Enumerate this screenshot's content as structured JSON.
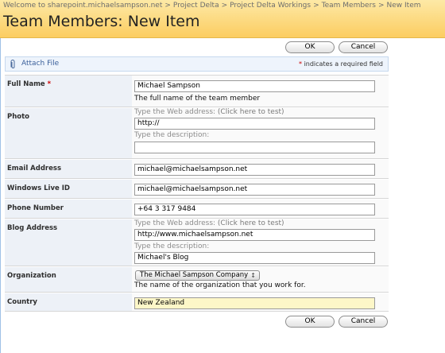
{
  "breadcrumb": [
    "Welcome to sharepoint.michaelsampson.net",
    "Project Delta",
    "Project Delta Workings",
    "Team Members",
    "New Item"
  ],
  "breadcrumb_separator": ">",
  "page_title": "Team Members: New Item",
  "buttons": {
    "ok": "OK",
    "cancel": "Cancel"
  },
  "toolbar": {
    "attach_label": "Attach File",
    "required_star": "*",
    "required_note": "indicates a required field"
  },
  "fields": {
    "full_name": {
      "label": "Full Name",
      "required_star": "*",
      "value": "Michael Sampson",
      "description": "The full name of the team member"
    },
    "photo": {
      "label": "Photo",
      "address_hint": "Type the Web address:",
      "test_link": "(Click here to test)",
      "address_value": "http://",
      "description_hint": "Type the description:",
      "description_value": ""
    },
    "email": {
      "label": "Email Address",
      "value": "michael@michaelsampson.net"
    },
    "live_id": {
      "label": "Windows Live ID",
      "value": "michael@michaelsampson.net"
    },
    "phone": {
      "label": "Phone Number",
      "value": "+64 3 317 9484"
    },
    "blog": {
      "label": "Blog Address",
      "address_hint": "Type the Web address:",
      "test_link": "(Click here to test)",
      "address_value": "http://www.michaelsampson.net",
      "description_hint": "Type the description:",
      "description_value": "Michael's Blog"
    },
    "organization": {
      "label": "Organization",
      "selected": "The Michael Sampson Company",
      "description": "The name of the organization that you work for."
    },
    "country": {
      "label": "Country",
      "value": "New Zealand"
    }
  },
  "icons": {
    "attach": "paperclip-icon",
    "select_arrow": "updown-arrow-icon"
  },
  "colors": {
    "header_top": "#fde9a6",
    "header_bottom": "#fccd61",
    "label_bg": "#edf1f7",
    "required": "#cc0000",
    "country_field": "#fdf7c8"
  }
}
